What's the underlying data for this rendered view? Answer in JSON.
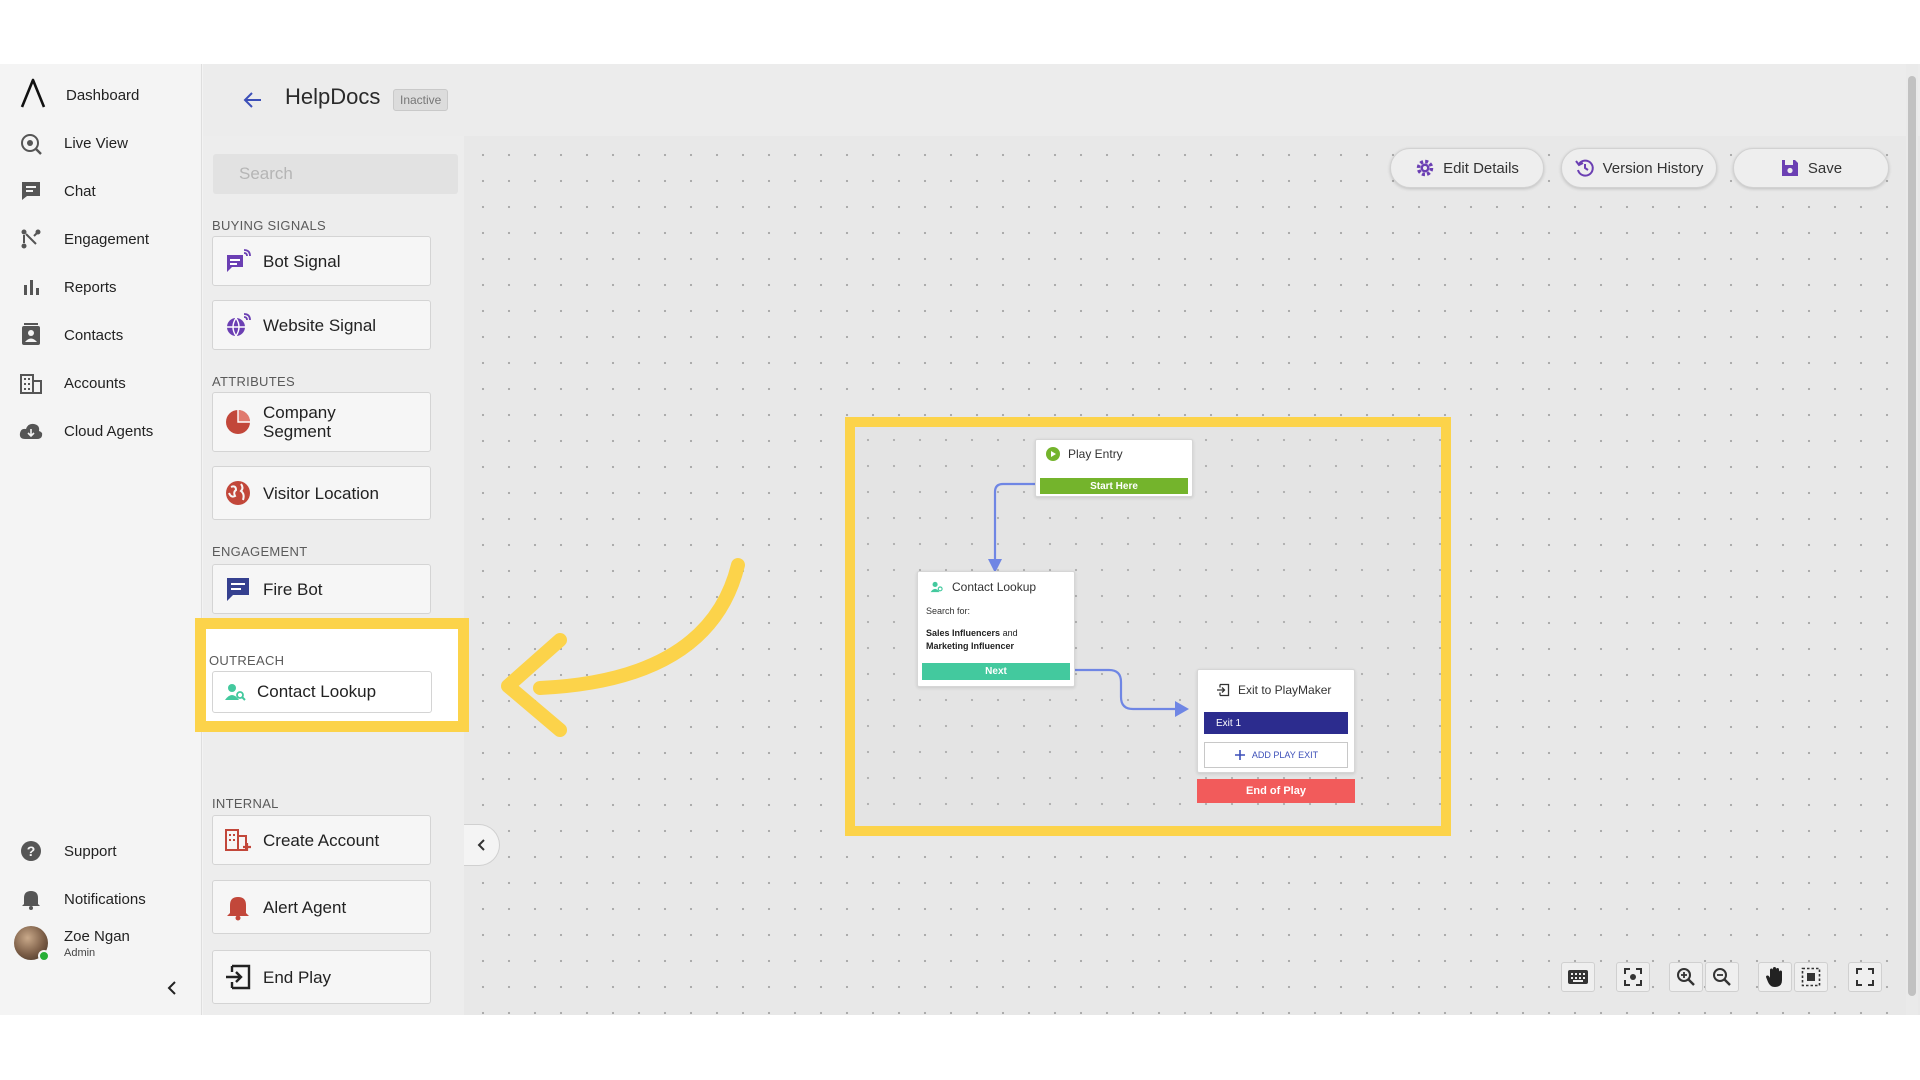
{
  "nav": {
    "items": [
      {
        "label": "Dashboard",
        "icon": "logo-icon"
      },
      {
        "label": "Live View",
        "icon": "live-view-icon"
      },
      {
        "label": "Chat",
        "icon": "chat-icon"
      },
      {
        "label": "Engagement",
        "icon": "engagement-icon"
      },
      {
        "label": "Reports",
        "icon": "reports-icon"
      },
      {
        "label": "Contacts",
        "icon": "contacts-icon"
      },
      {
        "label": "Accounts",
        "icon": "accounts-icon"
      },
      {
        "label": "Cloud Agents",
        "icon": "cloud-icon"
      }
    ],
    "support": "Support",
    "notifications": "Notifications",
    "user": {
      "name": "Zoe Ngan",
      "role": "Admin"
    }
  },
  "header": {
    "title": "HelpDocs",
    "status": "Inactive"
  },
  "palette": {
    "search_placeholder": "Search",
    "buying_signals": {
      "heading": "BUYING SIGNALS",
      "bot_signal": "Bot Signal",
      "website_signal": "Website Signal"
    },
    "attributes": {
      "heading": "ATTRIBUTES",
      "company_segment": "Company Segment",
      "visitor_location": "Visitor Location"
    },
    "engagement": {
      "heading": "ENGAGEMENT",
      "fire_bot": "Fire Bot"
    },
    "outreach": {
      "heading": "OUTREACH",
      "contact_lookup": "Contact Lookup"
    },
    "internal": {
      "heading": "INTERNAL",
      "create_account": "Create Account",
      "alert_agent": "Alert Agent",
      "end_play": "End Play"
    }
  },
  "toolbar": {
    "edit_details": "Edit Details",
    "version_history": "Version History",
    "save": "Save"
  },
  "flow": {
    "play_entry": {
      "title": "Play Entry",
      "button": "Start Here"
    },
    "contact_lookup": {
      "title": "Contact Lookup",
      "search_for": "Search for:",
      "criteria_bold_1": "Sales Influencers",
      "criteria_and": "and",
      "criteria_bold_2": "Marketing Influencer",
      "button": "Next"
    },
    "exit": {
      "title": "Exit to PlayMaker",
      "exit_label": "Exit 1",
      "add_exit": "ADD PLAY EXIT",
      "end": "End of Play"
    }
  },
  "colors": {
    "accent": "#fcd34a",
    "start": "#74b42c",
    "next": "#43c99e",
    "exit": "#2c2c8e",
    "end": "#f25b5b",
    "connector": "#6f86e4",
    "icon_purple": "#6b3fb3",
    "icon_red": "#c2473a"
  }
}
